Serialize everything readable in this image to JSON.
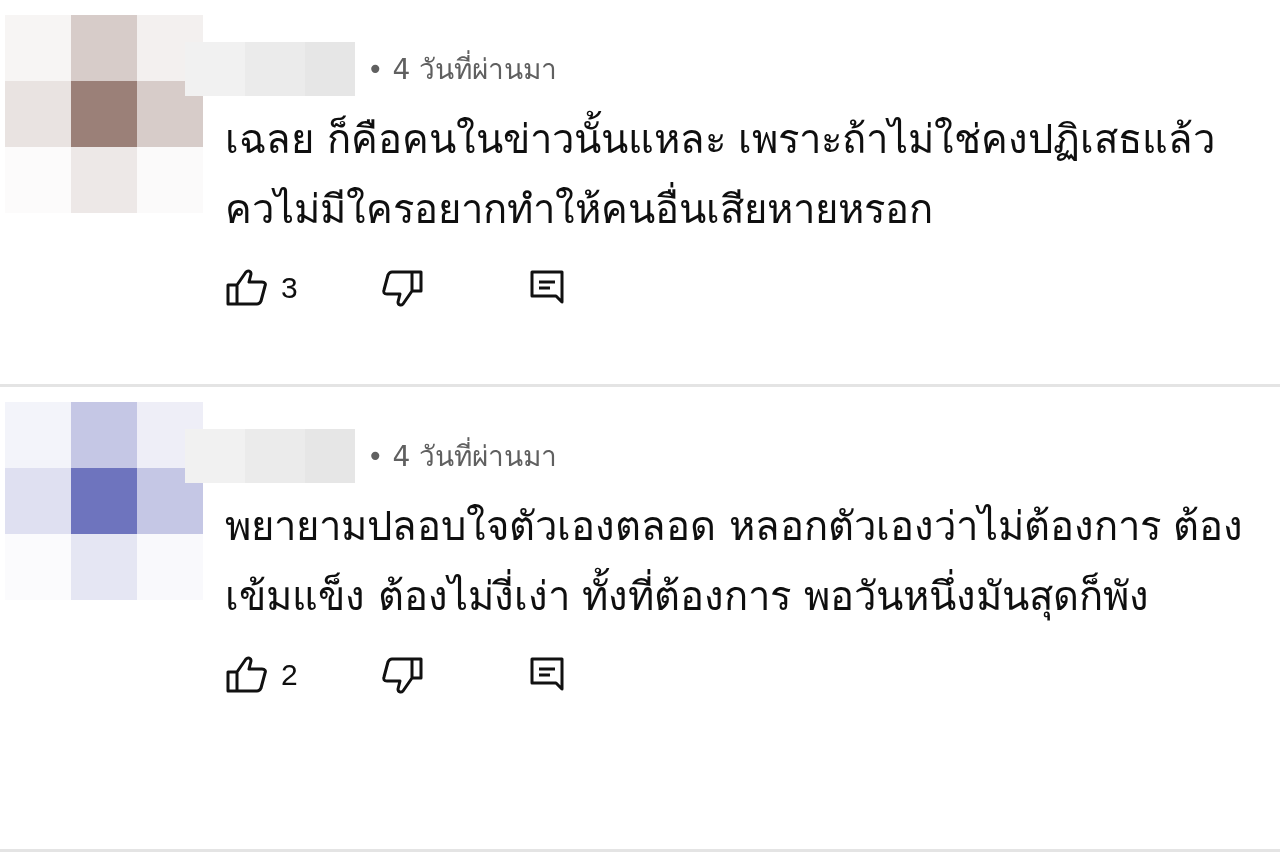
{
  "comments": [
    {
      "color": "#9b8078",
      "time": "• 4 วันที่ผ่านมา",
      "text": "เฉลย ก็คือคนในข่าวนั้นแหละ เพราะถ้าไม่ใช่คงปฏิเสธแล้ว ควไม่มีใครอยากทำให้คนอื่นเสียหายหรอก",
      "likes": "3"
    },
    {
      "color": "#6e74be",
      "time": "• 4 วันที่ผ่านมา",
      "text": "พยายามปลอบใจตัวเองตลอด หลอกตัวเองว่าไม่ต้องการ ต้องเข้มแข็ง ต้องไม่งี่เง่า ทั้งที่ต้องการ พอวันหนึ่งมันสุดก็พัง",
      "likes": "2"
    }
  ]
}
